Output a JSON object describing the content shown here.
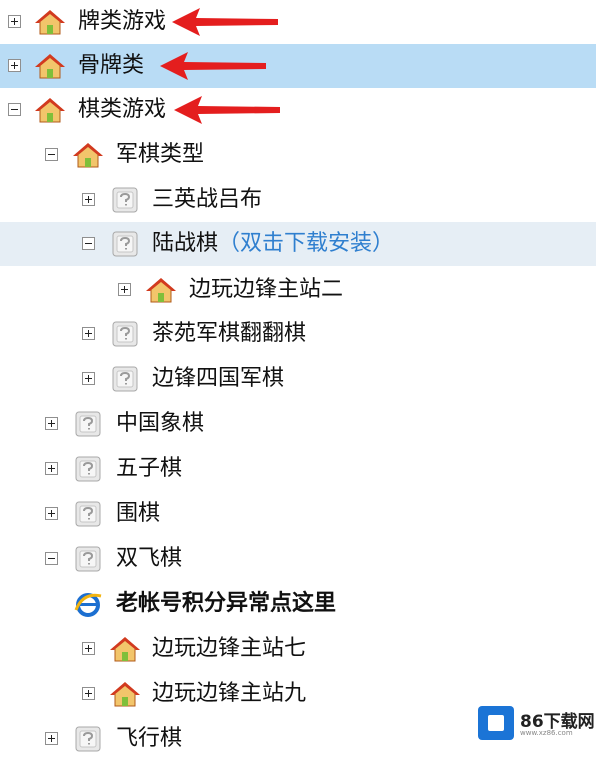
{
  "colors": {
    "selected_bg": "#b9dcf5",
    "hover_bg": "#e6eef5",
    "note_text": "#2f7fcf",
    "arrow": "#e41e1e"
  },
  "tree": {
    "top_level": [
      {
        "label": "牌类游戏",
        "icon": "house-icon",
        "expander": "plus"
      },
      {
        "label": "骨牌类",
        "icon": "house-icon",
        "expander": "plus",
        "selected": true
      },
      {
        "label": "棋类游戏",
        "icon": "house-icon",
        "expander": "minus"
      }
    ],
    "junqi": {
      "label": "军棋类型",
      "icon": "house-icon",
      "expander": "minus",
      "children": [
        {
          "label": "三英战吕布",
          "icon": "unknown-icon",
          "expander": "plus"
        },
        {
          "label": "陆战棋",
          "note": "（双击下载安装）",
          "icon": "unknown-icon",
          "expander": "minus",
          "children": [
            {
              "label": "边玩边锋主站二",
              "icon": "house-icon",
              "expander": "plus"
            }
          ]
        },
        {
          "label": "茶苑军棋翻翻棋",
          "icon": "unknown-icon",
          "expander": "plus"
        },
        {
          "label": "边锋四国军棋",
          "icon": "unknown-icon",
          "expander": "plus"
        }
      ]
    },
    "other_games": [
      {
        "label": "中国象棋",
        "icon": "unknown-icon",
        "expander": "plus"
      },
      {
        "label": "五子棋",
        "icon": "unknown-icon",
        "expander": "plus"
      },
      {
        "label": "围棋",
        "icon": "unknown-icon",
        "expander": "plus"
      }
    ],
    "feiqi": {
      "label": "双飞棋",
      "icon": "unknown-icon",
      "expander": "minus",
      "children": [
        {
          "label": "老帐号积分异常点这里",
          "icon": "ie-icon",
          "bold": true
        },
        {
          "label": "边玩边锋主站七",
          "icon": "house-icon",
          "expander": "plus"
        },
        {
          "label": "边玩边锋主站九",
          "icon": "house-icon",
          "expander": "plus"
        }
      ]
    },
    "last": {
      "label": "飞行棋",
      "icon": "unknown-icon",
      "expander": "plus"
    }
  },
  "watermark": {
    "title": "86下载网",
    "subtitle": "www.xz86.com"
  }
}
